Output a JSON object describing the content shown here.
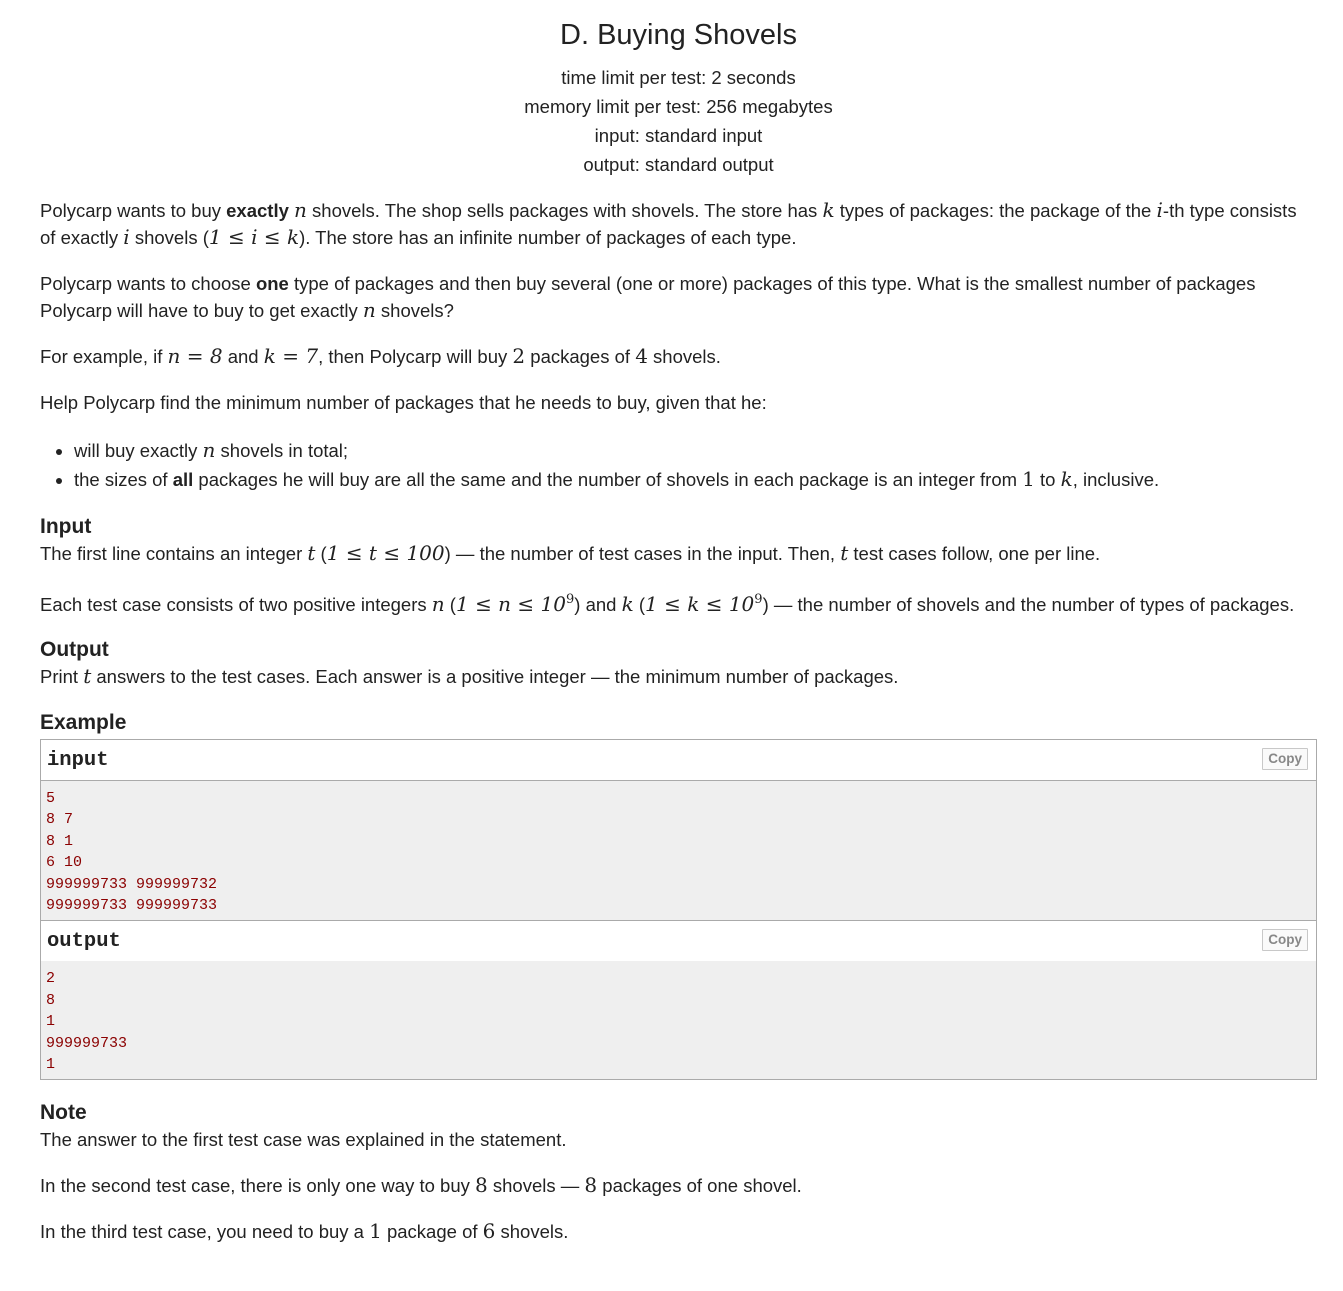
{
  "header": {
    "title": "D. Buying Shovels",
    "time_limit": "time limit per test: 2 seconds",
    "memory_limit": "memory limit per test: 256 megabytes",
    "input": "input: standard input",
    "output": "output: standard output"
  },
  "statement": {
    "p1_a": "Polycarp wants to buy ",
    "p1_b": "exactly",
    "p1_c": " shovels. The shop sells packages with shovels. The store has ",
    "p1_d": " types of packages: the package of the ",
    "p1_e": "-th type consists of exactly ",
    "p1_f": " shovels (",
    "p1_g": "). The store has an infinite number of packages of each type.",
    "p2_a": "Polycarp wants to choose ",
    "p2_b": "one",
    "p2_c": " type of packages and then buy several (one or more) packages of this type. What is the smallest number of packages Polycarp will have to buy to get exactly ",
    "p2_d": " shovels?",
    "p3_a": "For example, if ",
    "p3_b": " and ",
    "p3_c": ", then Polycarp will buy ",
    "p3_d": " packages of ",
    "p3_e": " shovels.",
    "p4": "Help Polycarp find the minimum number of packages that he needs to buy, given that he:",
    "b1_a": "will buy exactly ",
    "b1_b": " shovels in total;",
    "b2_a": "the sizes of ",
    "b2_b": "all",
    "b2_c": " packages he will buy are all the same and the number of shovels in each package is an integer from ",
    "b2_d": " to ",
    "b2_e": ", inclusive."
  },
  "math": {
    "n": "n",
    "k": "k",
    "i": "i",
    "t": "t",
    "range_i": "1 ≤ i ≤ k",
    "n_eq_8": "n = 8",
    "k_eq_7": "k = 7",
    "two": "2",
    "four": "4",
    "one": "1",
    "range_t": "1 ≤ t ≤ 100",
    "range_n_pre": "1 ≤ n ≤ 10",
    "range_k_pre": "1 ≤ k ≤ 10",
    "exp9": "9",
    "eight": "8",
    "six": "6"
  },
  "input_section": {
    "title": "Input",
    "p1_a": "The first line contains an integer ",
    "p1_b": " — the number of test cases in the input. Then, ",
    "p1_c": " test cases follow, one per line.",
    "p2_a": "Each test case consists of two positive integers ",
    "p2_b": " and ",
    "p2_c": " — the number of shovels and the number of types of packages."
  },
  "output_section": {
    "title": "Output",
    "p1_a": "Print ",
    "p1_b": " answers to the test cases. Each answer is a positive integer — the minimum number of packages."
  },
  "example": {
    "title": "Example",
    "input_label": "input",
    "output_label": "output",
    "copy_label": "Copy",
    "input_lines": [
      "5",
      "8 7",
      "8 1",
      "6 10",
      "999999733 999999732",
      "999999733 999999733"
    ],
    "output_lines": [
      "2",
      "8",
      "1",
      "999999733",
      "1"
    ]
  },
  "note": {
    "title": "Note",
    "p1": "The answer to the first test case was explained in the statement.",
    "p2_a": "In the second test case, there is only one way to buy ",
    "p2_b": " shovels — ",
    "p2_c": " packages of one shovel.",
    "p3_a": "In the third test case, you need to buy a ",
    "p3_b": " package of ",
    "p3_c": " shovels."
  }
}
